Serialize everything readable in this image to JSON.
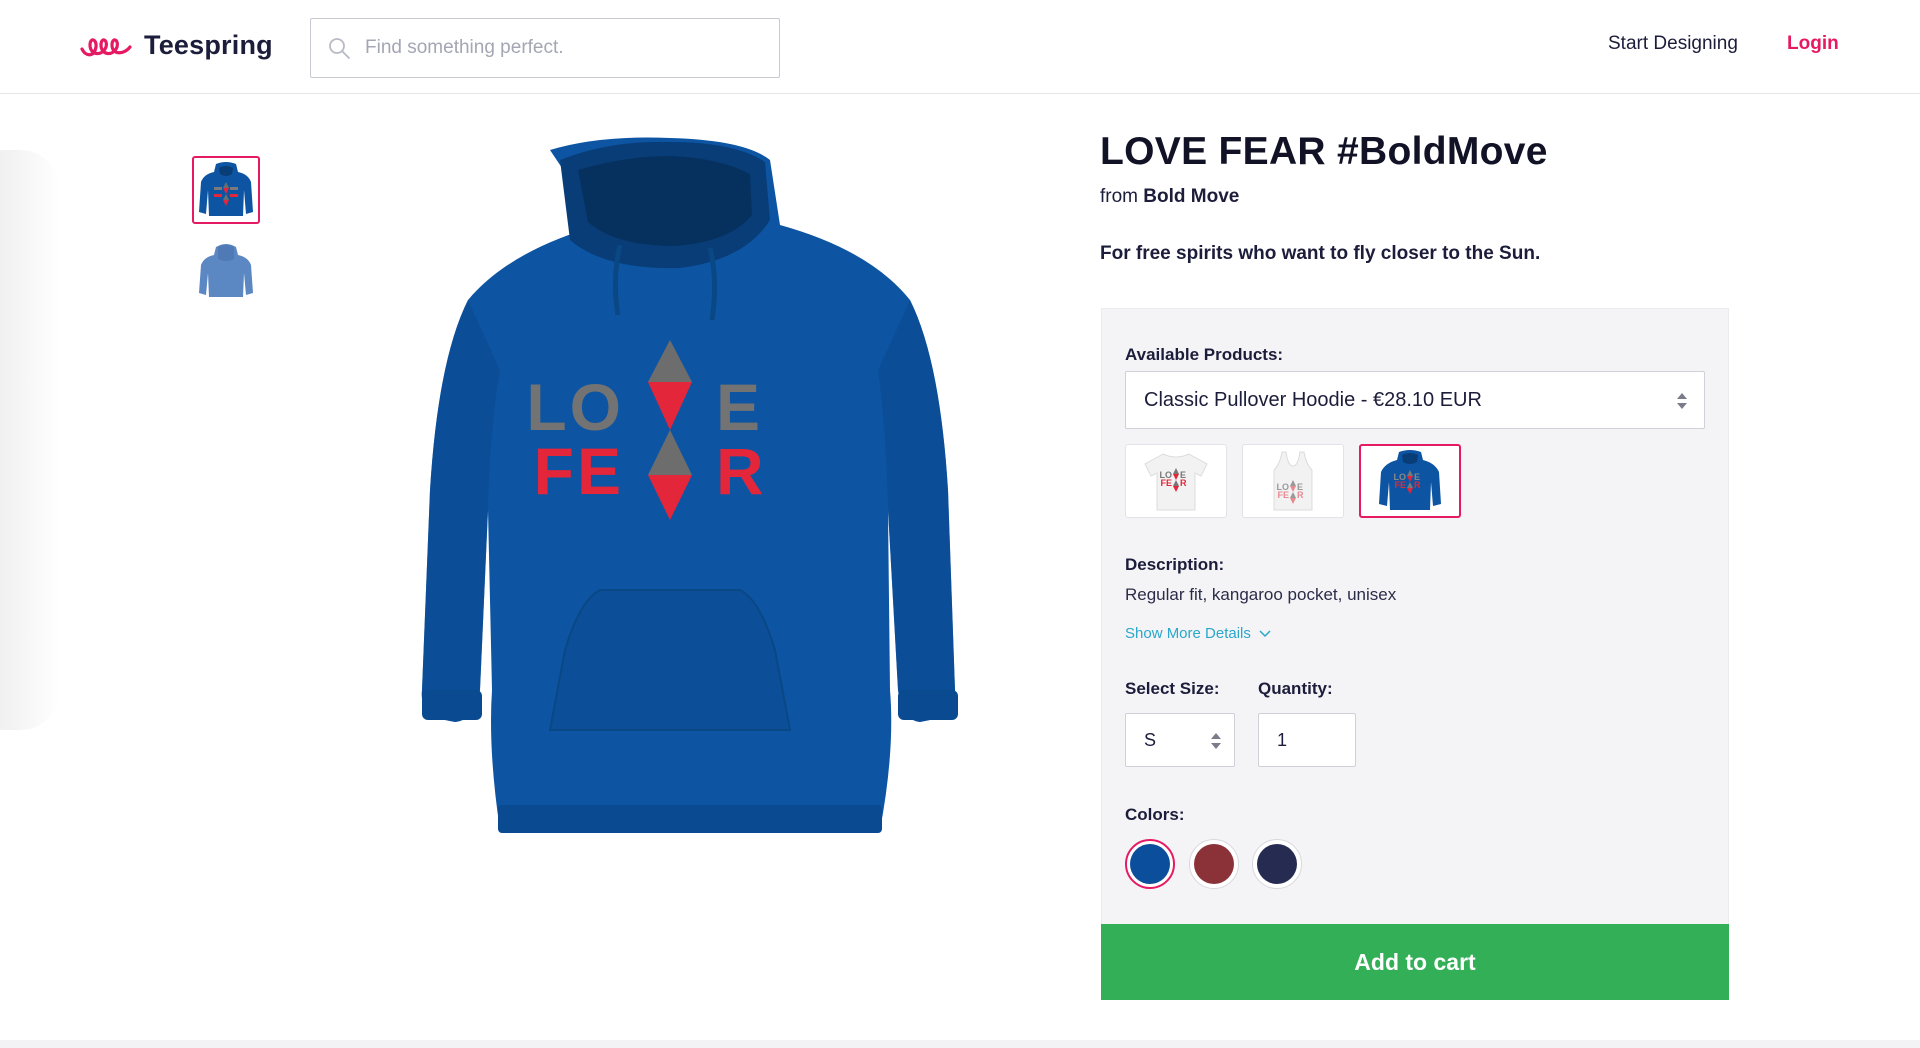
{
  "header": {
    "logo_text": "Teespring",
    "search_placeholder": "Find something perfect.",
    "start_designing": "Start Designing",
    "login": "Login"
  },
  "product": {
    "title": "LOVE FEAR #BoldMove",
    "from_prefix": "from",
    "seller": "Bold Move",
    "tagline": "For free spirits who want to fly closer to the Sun.",
    "design_words": [
      "LOVE",
      "FEAR"
    ]
  },
  "panel": {
    "available_products_label": "Available Products:",
    "selected_product": "Classic Pullover Hoodie - €28.10 EUR",
    "variants": [
      "t-shirt",
      "tank-top",
      "hoodie"
    ],
    "selected_variant": "hoodie",
    "description_label": "Description:",
    "description": "Regular fit, kangaroo pocket, unisex",
    "show_more": "Show More Details",
    "size_label": "Select Size:",
    "size_value": "S",
    "quantity_label": "Quantity:",
    "quantity_value": "1",
    "colors_label": "Colors:",
    "colors": [
      "#0b4f9c",
      "#8a3238",
      "#262b52"
    ],
    "selected_color": "#0b4f9c"
  },
  "cta": {
    "add_to_cart": "Add to cart"
  },
  "theme": {
    "accent": "#e61a63",
    "cta_green": "#33b057",
    "link_blue": "#2aa7c9",
    "hoodie_blue": "#0d55a3"
  }
}
